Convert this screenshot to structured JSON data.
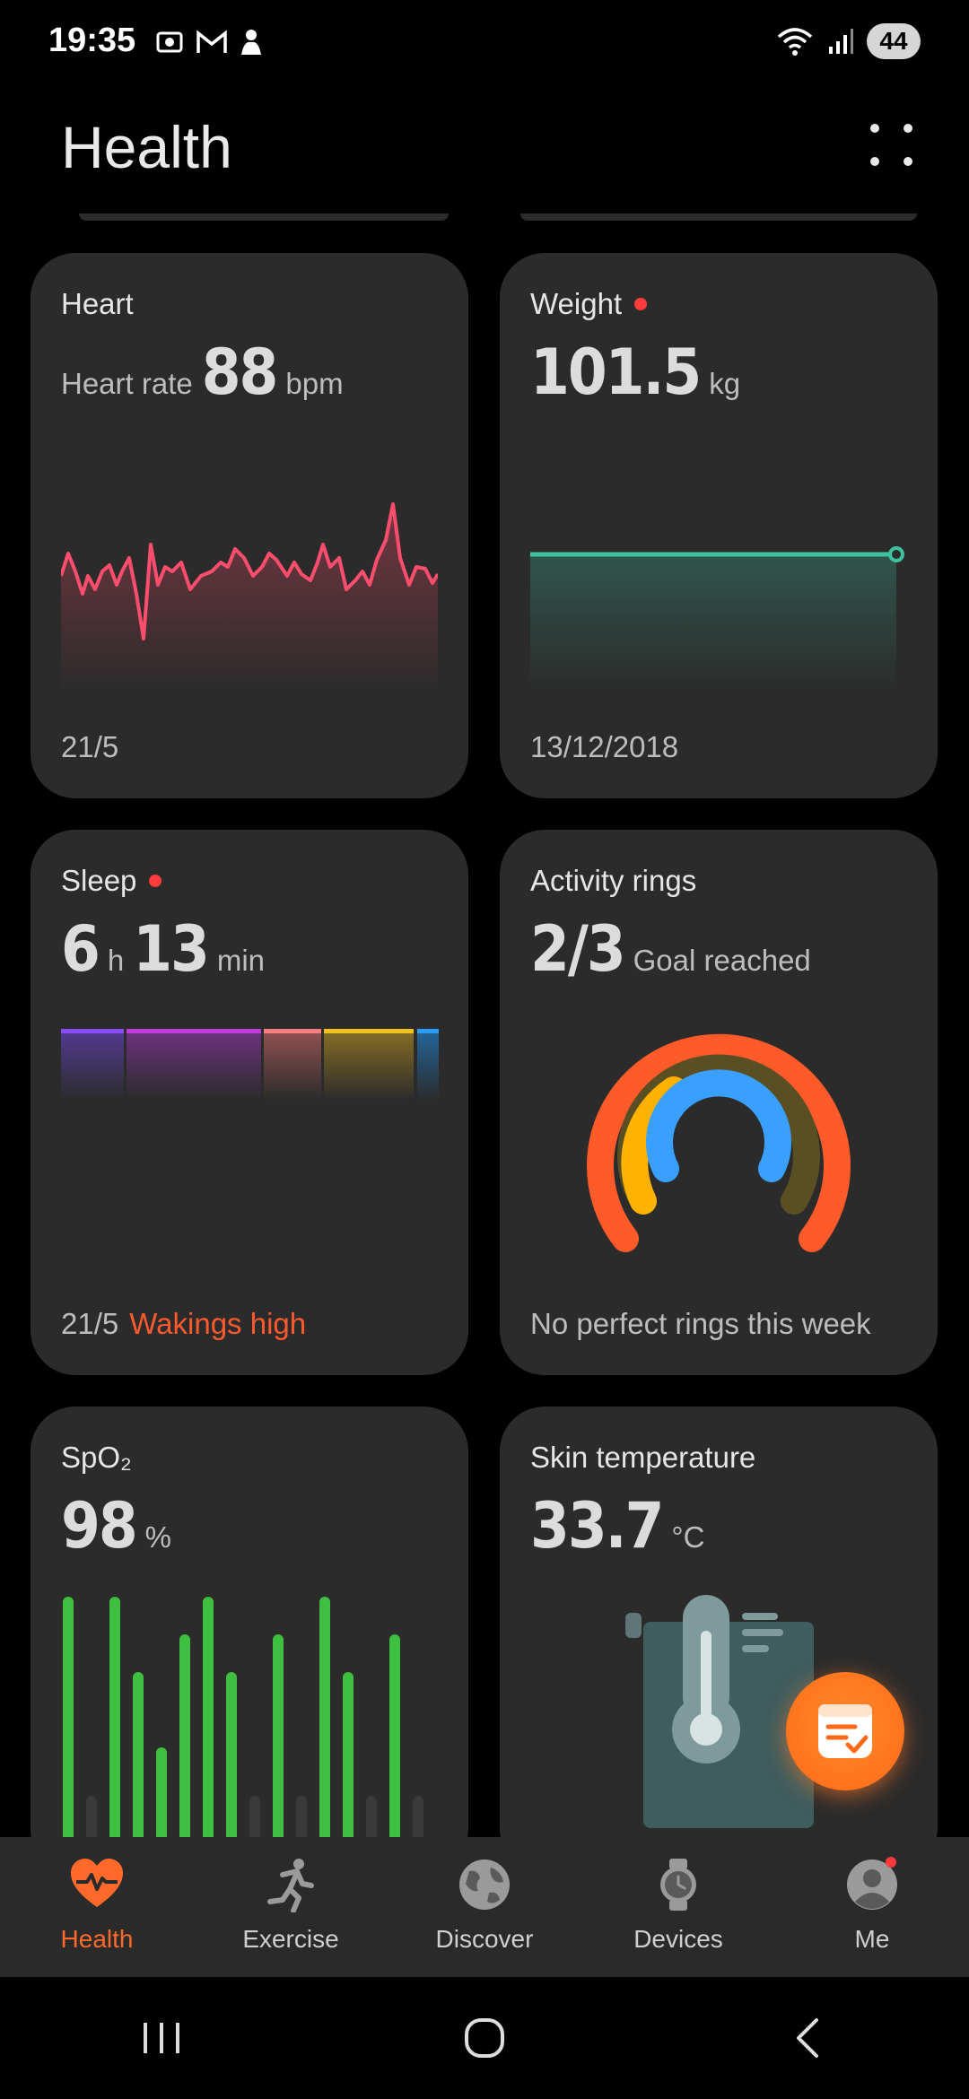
{
  "status_bar": {
    "time": "19:35",
    "battery": "44"
  },
  "header": {
    "title": "Health"
  },
  "cards": {
    "heart": {
      "title": "Heart",
      "prefix": "Heart rate",
      "value": "88",
      "unit": "bpm",
      "date": "21/5"
    },
    "weight": {
      "title": "Weight",
      "value": "101.5",
      "unit": "kg",
      "date": "13/12/2018"
    },
    "sleep": {
      "title": "Sleep",
      "hours": "6",
      "h_unit": "h",
      "minutes": "13",
      "min_unit": "min",
      "date": "21/5",
      "warning": "Wakings high"
    },
    "activity": {
      "title": "Activity rings",
      "value": "2/3",
      "label": "Goal reached",
      "footer": "No perfect rings this week"
    },
    "spo2": {
      "title": "SpO₂",
      "value": "98",
      "unit": "%"
    },
    "skin": {
      "title": "Skin temperature",
      "value": "33.7",
      "unit": "°C"
    }
  },
  "nav": {
    "items": [
      {
        "label": "Health"
      },
      {
        "label": "Exercise"
      },
      {
        "label": "Discover"
      },
      {
        "label": "Devices"
      },
      {
        "label": "Me"
      }
    ]
  },
  "colors": {
    "accent": "#ff6a2a",
    "heart_line": "#ff4d6d",
    "weight_line": "#3fc1a0",
    "spo2_bar": "#3fbf3f"
  }
}
